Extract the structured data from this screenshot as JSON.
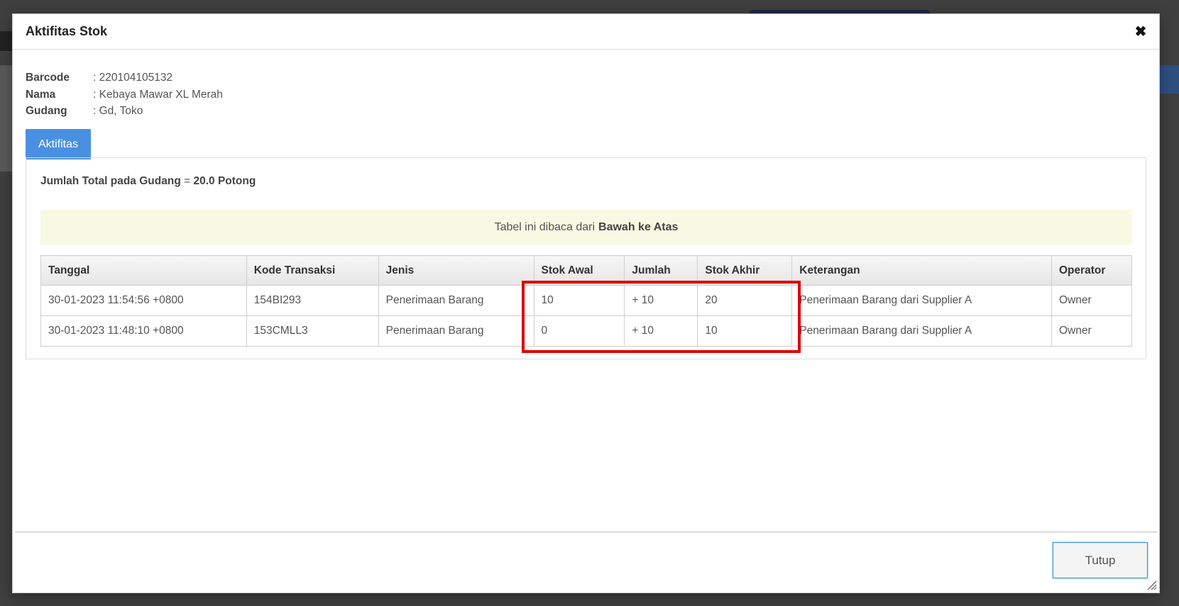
{
  "modal": {
    "title": "Aktifitas Stok",
    "close_icon": "close-icon"
  },
  "info": [
    {
      "label": "Barcode",
      "value": ": 220104105132"
    },
    {
      "label": "Nama",
      "value": ": Kebaya Mawar XL Merah"
    },
    {
      "label": "Gudang",
      "value": ": Gd, Toko"
    }
  ],
  "tabs": [
    {
      "label": "Aktifitas",
      "active": true
    }
  ],
  "summary": {
    "prefix": "Jumlah Total pada Gudang",
    "equals": "=",
    "value": "20.0 Potong"
  },
  "notice": {
    "text": "Tabel ini dibaca dari",
    "bold": "Bawah ke Atas"
  },
  "table": {
    "headers": [
      "Tanggal",
      "Kode Transaksi",
      "Jenis",
      "Stok Awal",
      "Jumlah",
      "Stok Akhir",
      "Keterangan",
      "Operator"
    ],
    "rows": [
      [
        "30-01-2023 11:54:56 +0800",
        "154BI293",
        "Penerimaan Barang",
        "10",
        "+ 10",
        "20",
        "Penerimaan Barang dari Supplier A",
        "Owner"
      ],
      [
        "30-01-2023 11:48:10 +0800",
        "153CMLL3",
        "Penerimaan Barang",
        "0",
        "+ 10",
        "10",
        "Penerimaan Barang dari Supplier A",
        "Owner"
      ]
    ]
  },
  "footer": {
    "close_button": "Tutup"
  },
  "colors": {
    "tab_active": "#4a90e2",
    "notice_bg": "#f7f9e3",
    "highlight": "#e00000",
    "button_border": "#2f8fe0"
  }
}
